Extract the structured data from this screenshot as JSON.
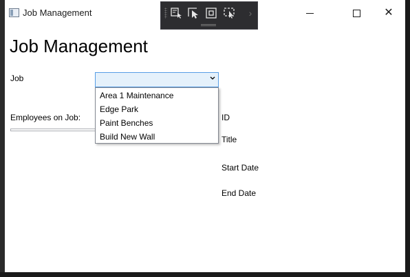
{
  "window": {
    "title": "Job Management",
    "minimize_icon": "minimize-icon",
    "maximize_icon": "maximize-icon",
    "close_icon": "close-icon"
  },
  "debug_toolbar": {
    "icons": [
      "select-element-icon",
      "pointer-icon",
      "display-layout-adorners-icon",
      "track-focus-icon",
      "chevron-right-icon"
    ]
  },
  "page": {
    "heading": "Job Management",
    "job_label": "Job",
    "employees_label": "Employees on Job:",
    "id_label": "ID",
    "title_label": "Title",
    "start_date_label": "Start Date",
    "end_date_label": "End Date"
  },
  "job_combo": {
    "selected": "",
    "options": [
      "Area 1 Maintenance",
      "Edge Park",
      "Paint Benches",
      "Build New Wall"
    ]
  },
  "colors": {
    "combo_border": "#569de5",
    "combo_fill": "#e5f1fb",
    "toolbar_bg": "#2d2d30"
  }
}
